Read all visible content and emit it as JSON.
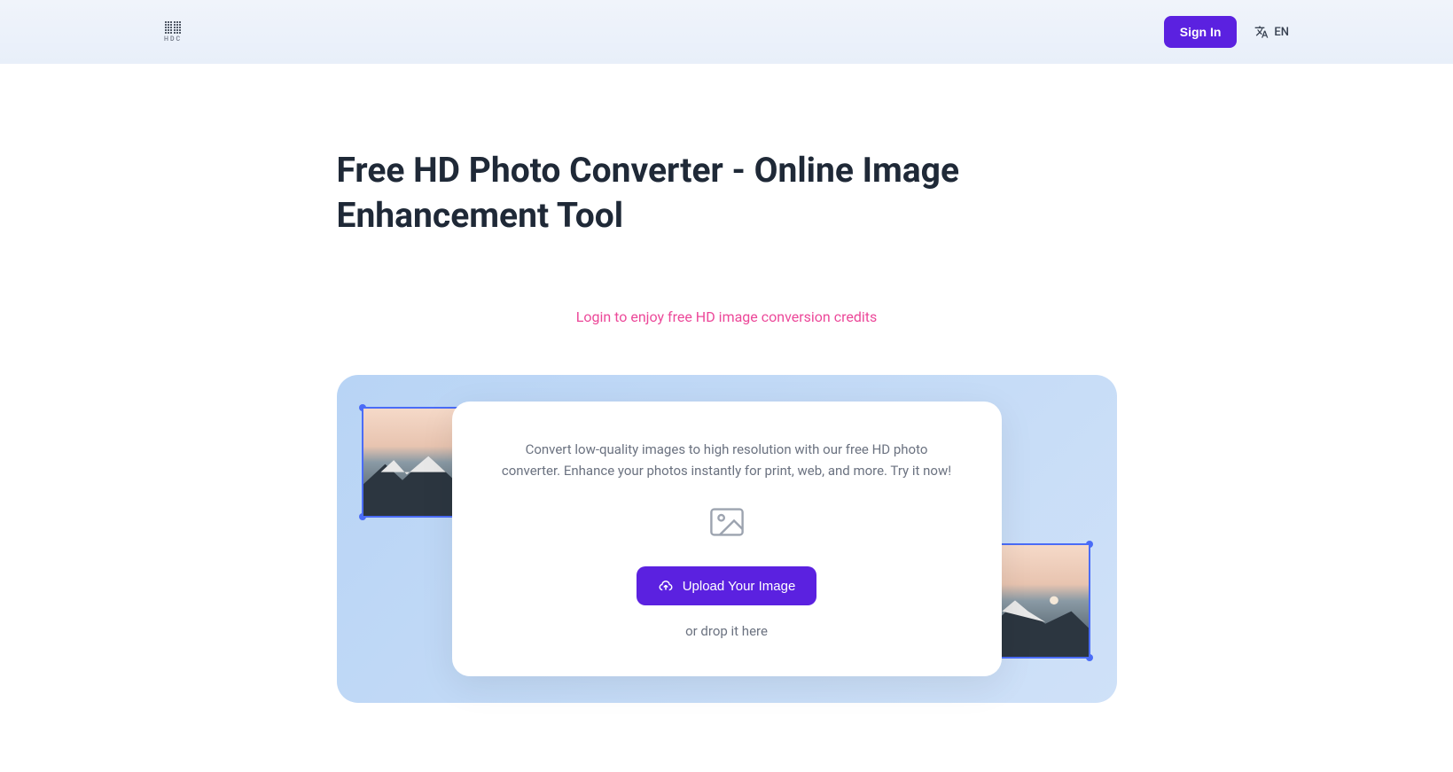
{
  "header": {
    "logo_text": "HDC",
    "sign_in_label": "Sign In",
    "language": "EN"
  },
  "main": {
    "title": "Free HD Photo Converter - Online Image Enhancement Tool",
    "cta_link_text": "Login to enjoy free HD image conversion credits",
    "upload_card": {
      "description": "Convert low-quality images to high resolution with our free HD photo converter. Enhance your photos instantly for print, web, and more. Try it now!",
      "upload_button_label": "Upload Your Image",
      "drop_text": "or drop it here"
    }
  },
  "colors": {
    "accent": "#5b21e0",
    "pink": "#ec4899",
    "panel_bg": "#b8d4f5"
  }
}
